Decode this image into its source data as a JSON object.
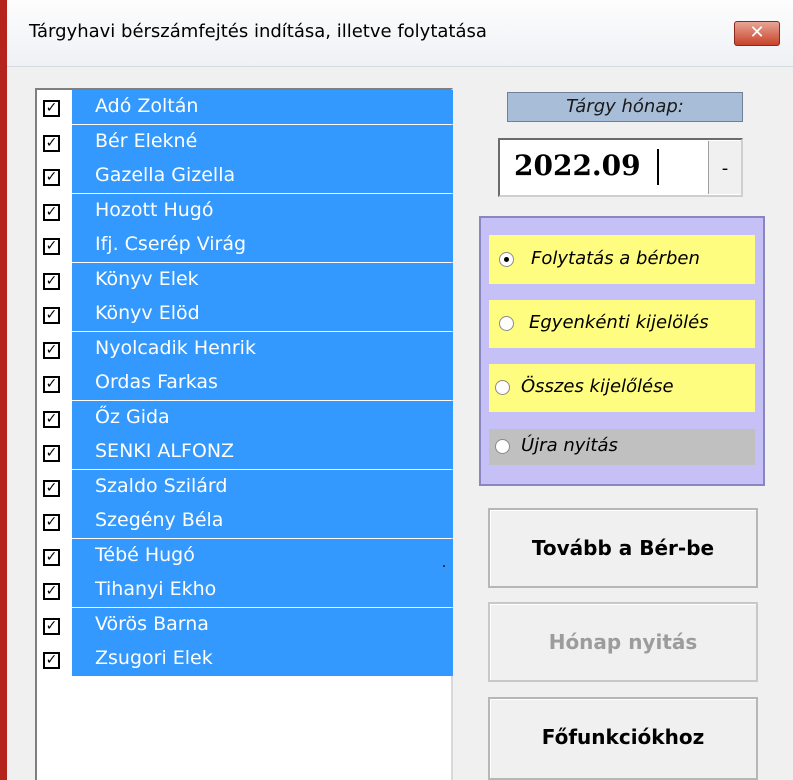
{
  "window": {
    "title": "Tárgyhavi bérszámfejtés indítása, illetve folytatása",
    "close_label": "✕"
  },
  "employees": [
    {
      "name": "Adó Zoltán",
      "checked": true
    },
    {
      "name": "Bér Elekné",
      "checked": true
    },
    {
      "name": "Gazella Gizella",
      "checked": true
    },
    {
      "name": "Hozott Hugó",
      "checked": true
    },
    {
      "name": "Ifj. Cserép Virág",
      "checked": true
    },
    {
      "name": "Könyv Elek",
      "checked": true
    },
    {
      "name": "Könyv Elöd",
      "checked": true
    },
    {
      "name": "Nyolcadik Henrik",
      "checked": true
    },
    {
      "name": "Ordas Farkas",
      "checked": true
    },
    {
      "name": "Őz Gida",
      "checked": true
    },
    {
      "name": "SENKI ALFONZ",
      "checked": true
    },
    {
      "name": "Szaldo Szilárd",
      "checked": true
    },
    {
      "name": "Szegény Béla",
      "checked": true
    },
    {
      "name": "Tébé Hugó",
      "checked": true
    },
    {
      "name": "Tihanyi Ekho",
      "checked": true
    },
    {
      "name": "Vörös Barna",
      "checked": true
    },
    {
      "name": "Zsugori Elek",
      "checked": true
    }
  ],
  "month": {
    "label": "Tárgy hónap:",
    "value": "2022.09"
  },
  "options": [
    {
      "label": "Folytatás a bérben",
      "selected": true
    },
    {
      "label": "Egyenkénti kijelölés",
      "selected": false
    },
    {
      "label": "Összes kijelőlése",
      "selected": false
    },
    {
      "label": "Újra nyitás",
      "selected": false
    }
  ],
  "buttons": {
    "continue": "Tovább a Bér-be",
    "open_month": "Hónap nyitás",
    "main_functions": "Főfunkciókhoz"
  },
  "colors": {
    "selection": "#3399ff",
    "option_frame": "#c5c0f6",
    "option_yellow": "#fffd7f",
    "option_gray": "#c0c0c0",
    "month_label_bg": "#a7bdd8"
  }
}
